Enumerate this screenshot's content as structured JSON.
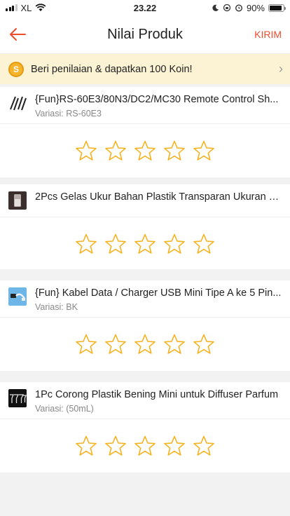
{
  "status_bar": {
    "carrier": "XL",
    "time": "23.22",
    "battery": "90%"
  },
  "nav": {
    "title": "Nilai Produk",
    "send_label": "KIRIM"
  },
  "banner": {
    "coin_symbol": "S",
    "text": "Beri penilaian & dapatkan 100 Koin!"
  },
  "colors": {
    "accent": "#ee4d2d",
    "star": "#f5b21e",
    "banner_bg": "#fbf3d4"
  },
  "products": [
    {
      "name": "{Fun}RS-60E3/80N3/DC2/MC30 Remote Control Sh...",
      "variant": "Variasi: RS-60E3",
      "rating": 0
    },
    {
      "name": "2Pcs Gelas Ukur Bahan Plastik Transparan Ukuran 1...",
      "variant": "",
      "rating": 0
    },
    {
      "name": "{Fun} Kabel Data / Charger USB Mini Tipe A ke 5 Pin...",
      "variant": "Variasi: BK",
      "rating": 0
    },
    {
      "name": "1Pc Corong Plastik Bening Mini untuk Diffuser Parfum",
      "variant": "Variasi: (50mL)",
      "rating": 0
    }
  ]
}
